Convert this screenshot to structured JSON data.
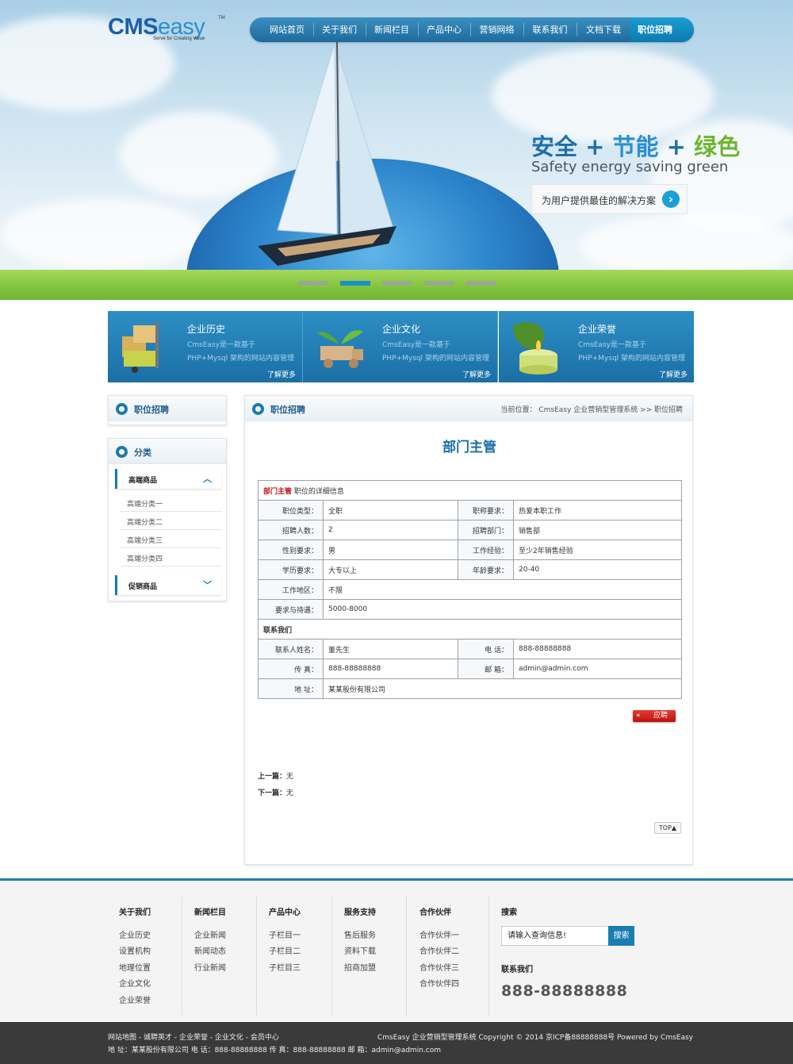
{
  "brand": {
    "logo_cms": "CMS",
    "logo_easy": "easy",
    "logo_tm": "TM",
    "logo_slogan": "Serve for Creating Value"
  },
  "nav": {
    "items": [
      "网站首页",
      "关于我们",
      "新闻栏目",
      "产品中心",
      "营销网络",
      "联系我们",
      "文档下载",
      "职位招聘"
    ],
    "active_index": 7
  },
  "banner": {
    "slogan_part1": "安全",
    "slogan_plus1": "+",
    "slogan_part2": "节能",
    "slogan_plus2": "+",
    "slogan_part3": "绿色",
    "slogan_en": "Safety energy saving  green",
    "cta_text": "为用户提供最佳的解决方案",
    "cta_icon": "arrow-right-icon",
    "slide_count": 5,
    "active_slide": 2
  },
  "features": [
    {
      "title": "企业历史",
      "desc_line1": "CmsEasy是一款基于",
      "desc_line2": "PHP+Mysql 架构的网站内容管理",
      "more": "了解更多",
      "icon": "boxes-cart-icon"
    },
    {
      "title": "企业文化",
      "desc_line1": "CmsEasy是一款基于",
      "desc_line2": "PHP+Mysql 架构的网站内容管理",
      "more": "了解更多",
      "icon": "sprout-truck-icon"
    },
    {
      "title": "企业荣誉",
      "desc_line1": "CmsEasy是一款基于",
      "desc_line2": "PHP+Mysql 架构的网站内容管理",
      "more": "了解更多",
      "icon": "candle-leaf-icon"
    }
  ],
  "sidebar": {
    "box1_title": "职位招聘",
    "box2_title": "分类",
    "cat1": "高端商品",
    "subcats": [
      "高端分类一",
      "高端分类二",
      "高端分类三",
      "高端分类四"
    ],
    "cat2": "促销商品"
  },
  "main": {
    "box_title": "职位招聘",
    "crumb": "当前位置： CmsEasy 企业营销型管理系统  >>  职位招聘",
    "job_title": "部门主管",
    "table_head_red": "部门主管",
    "table_head_rest": " 职位的详细信息",
    "rows": [
      {
        "l1": "职位类型：",
        "v1": "全职",
        "l2": "职称要求：",
        "v2": "热爱本职工作"
      },
      {
        "l1": "招聘人数：",
        "v1": "2",
        "l2": "招聘部门：",
        "v2": "销售部"
      },
      {
        "l1": "性别要求：",
        "v1": "男",
        "l2": "工作经验：",
        "v2": "至少2年销售经验"
      },
      {
        "l1": "学历要求：",
        "v1": "大专以上",
        "l2": "年龄要求：",
        "v2": "20-40"
      }
    ],
    "area_label": "工作地区：",
    "area_value": "不限",
    "pay_label": "要求与待遇：",
    "pay_value": "5000-8000",
    "contact_head": "联系我们",
    "contact_name_label": "联系人姓名：",
    "contact_name": "董先生",
    "tel_label": "电  话：",
    "tel": "888-88888888",
    "fax_label": "传  真：",
    "fax": "888-88888888",
    "email_label": "邮  箱：",
    "email": "admin@admin.com",
    "addr_label": "地  址：",
    "addr": "某某股份有限公司",
    "apply_arrow": "«",
    "apply_label": "应聘",
    "prev_label": "上一篇：",
    "prev_value": "无",
    "next_label": "下一篇：",
    "next_value": "无",
    "top_label": "TOP▲"
  },
  "footer": {
    "cols": [
      {
        "head": "关于我们",
        "links": [
          "企业历史",
          "设置机构",
          "地理位置",
          "企业文化",
          "企业荣誉"
        ]
      },
      {
        "head": "新闻栏目",
        "links": [
          "企业新闻",
          "新闻动态",
          "行业新闻"
        ]
      },
      {
        "head": "产品中心",
        "links": [
          "子栏目一",
          "子栏目二",
          "子栏目三"
        ]
      },
      {
        "head": "服务支持",
        "links": [
          "售后服务",
          "资料下载",
          "招商加盟"
        ]
      },
      {
        "head": "合作伙伴",
        "links": [
          "合作伙伴一",
          "合作伙伴二",
          "合作伙伴三",
          "合作伙伴四"
        ]
      }
    ],
    "search_head": "搜索",
    "search_placeholder": "请输入查询信息!",
    "search_button": "搜索",
    "contact_head": "联系我们",
    "phone": "888-88888888"
  },
  "bottom": {
    "links": "网站地图 - 诚聘英才 - 企业荣誉 - 企业文化 - 会员中心",
    "copyright": "CmsEasy 企业营销型管理系统  Copyright © 2014  京ICP备88888888号  Powered by CmsEasy",
    "contact": "地 址：某某股份有限公司  电 话：888-88888888  传 真：888-88888888  邮 箱：admin@admin.com"
  }
}
